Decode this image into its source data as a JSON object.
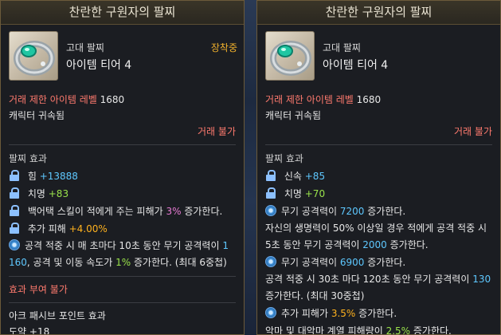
{
  "left": {
    "title": "찬란한 구원자의 팔찌",
    "type": "고대 팔찌",
    "tier": "아이템 티어 4",
    "equipped": "장착중",
    "trade_level_label": "거래 제한 아이템 레벨",
    "trade_level_value": "1680",
    "bound": "캐릭터 귀속됨",
    "trade": "거래 불가",
    "effects_title": "팔찌 효과",
    "stat1_name": "힘",
    "stat1_value": "+13888",
    "stat2_name": "치명",
    "stat2_value": "+83",
    "eff1_pre": "백어택 스킬이 적에게 주는 피해가 ",
    "eff1_val": "3%",
    "eff1_post": " 증가한다.",
    "eff2_pre": "추가 피해 ",
    "eff2_val": "+4.00%",
    "eff3_a": "공격 적중 시 매 초마다 10초 동안 무기 공격력이 ",
    "eff3_v1": "1",
    "eff3_b_v": "160",
    "eff3_c": ", 공격 및 이동 속도가 ",
    "eff3_v2": "1%",
    "eff3_d": " 증가한다. (최대 6중첩)",
    "no_effect": "효과 부여 불가",
    "ark_title": "아크 패시브 포인트 효과",
    "ark_value": "도약 +18"
  },
  "right": {
    "title": "찬란한 구원자의 팔찌",
    "type": "고대 팔찌",
    "tier": "아이템 티어 4",
    "trade_level_label": "거래 제한 아이템 레벨",
    "trade_level_value": "1680",
    "bound": "캐릭터 귀속됨",
    "trade": "거래 불가",
    "effects_title": "팔찌 효과",
    "stat1_name": "신속",
    "stat1_value": "+85",
    "stat2_name": "치명",
    "stat2_value": "+70",
    "eff1_pre": "무기 공격력이 ",
    "eff1_val": "7200",
    "eff1_post": " 증가한다.",
    "eff2_line1": "자신의 생명력이 50% 이상일 경우 적에게 공격 적중 시",
    "eff2_line2_pre": "5초 동안 무기 공격력이 ",
    "eff2_line2_val": "2000",
    "eff2_line2_post": " 증가한다.",
    "eff3_pre": "무기 공격력이 ",
    "eff3_val": "6900",
    "eff3_post": " 증가한다.",
    "eff4_line1_pre": "공격 적중 시 30초 마다 120초 동안 무기 공격력이 ",
    "eff4_line1_val": "130",
    "eff4_line2": "증가한다. (최대 30중첩)",
    "eff5_pre": "추가 피해가 ",
    "eff5_val": "3.5%",
    "eff5_post": " 증가한다.",
    "eff6_pre": "악마 및 대악마 계열 피해량이 ",
    "eff6_val": "2.5%",
    "eff6_post": " 증가한다."
  },
  "colors": {
    "border": "#6b5a3a",
    "blue_value": "#5ec8ff",
    "green_value": "#9ae34b",
    "orange_value": "#ffb21e",
    "pink_value": "#e77bd3",
    "red_label": "#ff7a6e",
    "gold": "#f0b02c"
  },
  "icons": [
    "bracelet-icon",
    "lock-icon",
    "swirl-effect-icon"
  ]
}
